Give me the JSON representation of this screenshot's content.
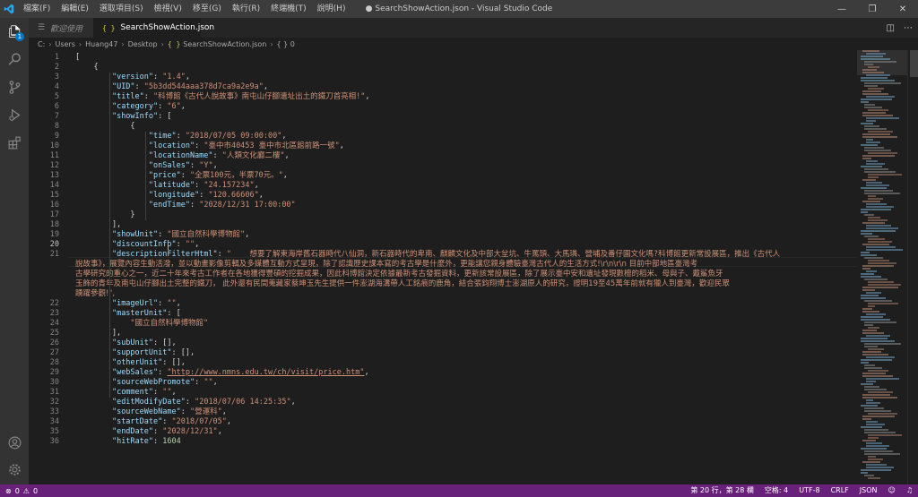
{
  "window": {
    "title": "● SearchShowAction.json - Visual Studio Code",
    "menu": [
      "檔案(F)",
      "編輯(E)",
      "選取項目(S)",
      "檢視(V)",
      "移至(G)",
      "執行(R)",
      "終端機(T)",
      "說明(H)"
    ]
  },
  "activity": {
    "explorer_badge": "1",
    "icons": [
      "files-icon",
      "search-icon",
      "source-control-icon",
      "run-debug-icon",
      "extensions-icon",
      "account-icon",
      "settings-gear-icon"
    ]
  },
  "tabs": [
    {
      "label": "歡迎使用",
      "state": "inactive"
    },
    {
      "label": "SearchShowAction.json",
      "state": "active",
      "modified": true
    }
  ],
  "breadcrumb": {
    "parts": [
      "C:",
      "Users",
      "Huang47",
      "Desktop"
    ],
    "file_glyph": "{ }",
    "file": "SearchShowAction.json",
    "symbol": "{ } 0"
  },
  "editor": {
    "current_line": "20",
    "lines": [
      {
        "n": "1",
        "tokens": [
          [
            "p",
            "["
          ]
        ]
      },
      {
        "n": "2",
        "tokens": [
          [
            "p",
            "    {"
          ]
        ]
      },
      {
        "n": "3",
        "tokens": [
          [
            "p",
            "        "
          ],
          [
            "k",
            "\"version\""
          ],
          [
            "p",
            ": "
          ],
          [
            "s",
            "\"1.4\""
          ],
          [
            "p",
            ","
          ]
        ]
      },
      {
        "n": "4",
        "tokens": [
          [
            "p",
            "        "
          ],
          [
            "k",
            "\"UID\""
          ],
          [
            "p",
            ": "
          ],
          [
            "s",
            "\"5b3dd544aaa378d7ca9a2e9a\""
          ],
          [
            "p",
            ","
          ]
        ]
      },
      {
        "n": "5",
        "tokens": [
          [
            "p",
            "        "
          ],
          [
            "k",
            "\"title\""
          ],
          [
            "p",
            ": "
          ],
          [
            "s",
            "\"科博館《古代人說故事》南屯山仔腳遺址出土的鐵刀首亮相!\""
          ],
          [
            "p",
            ","
          ]
        ]
      },
      {
        "n": "6",
        "tokens": [
          [
            "p",
            "        "
          ],
          [
            "k",
            "\"category\""
          ],
          [
            "p",
            ": "
          ],
          [
            "s",
            "\"6\""
          ],
          [
            "p",
            ","
          ]
        ]
      },
      {
        "n": "7",
        "tokens": [
          [
            "p",
            "        "
          ],
          [
            "k",
            "\"showInfo\""
          ],
          [
            "p",
            ": ["
          ]
        ]
      },
      {
        "n": "8",
        "tokens": [
          [
            "p",
            "            {"
          ]
        ]
      },
      {
        "n": "9",
        "tokens": [
          [
            "p",
            "                "
          ],
          [
            "k",
            "\"time\""
          ],
          [
            "p",
            ": "
          ],
          [
            "s",
            "\"2018/07/05 09:00:00\""
          ],
          [
            "p",
            ","
          ]
        ]
      },
      {
        "n": "10",
        "tokens": [
          [
            "p",
            "                "
          ],
          [
            "k",
            "\"location\""
          ],
          [
            "p",
            ": "
          ],
          [
            "s",
            "\"臺中市40453 臺中市北區館前路一號\""
          ],
          [
            "p",
            ","
          ]
        ]
      },
      {
        "n": "11",
        "tokens": [
          [
            "p",
            "                "
          ],
          [
            "k",
            "\"locationName\""
          ],
          [
            "p",
            ": "
          ],
          [
            "s",
            "\"人類文化廳二樓\""
          ],
          [
            "p",
            ","
          ]
        ]
      },
      {
        "n": "12",
        "tokens": [
          [
            "p",
            "                "
          ],
          [
            "k",
            "\"onSales\""
          ],
          [
            "p",
            ": "
          ],
          [
            "s",
            "\"Y\""
          ],
          [
            "p",
            ","
          ]
        ]
      },
      {
        "n": "13",
        "tokens": [
          [
            "p",
            "                "
          ],
          [
            "k",
            "\"price\""
          ],
          [
            "p",
            ": "
          ],
          [
            "s",
            "\"全票100元，半票70元。\""
          ],
          [
            "p",
            ","
          ]
        ]
      },
      {
        "n": "14",
        "tokens": [
          [
            "p",
            "                "
          ],
          [
            "k",
            "\"latitude\""
          ],
          [
            "p",
            ": "
          ],
          [
            "s",
            "\"24.157234\""
          ],
          [
            "p",
            ","
          ]
        ]
      },
      {
        "n": "15",
        "tokens": [
          [
            "p",
            "                "
          ],
          [
            "k",
            "\"longitude\""
          ],
          [
            "p",
            ": "
          ],
          [
            "s",
            "\"120.66606\""
          ],
          [
            "p",
            ","
          ]
        ]
      },
      {
        "n": "16",
        "tokens": [
          [
            "p",
            "                "
          ],
          [
            "k",
            "\"endTime\""
          ],
          [
            "p",
            ": "
          ],
          [
            "s",
            "\"2028/12/31 17:00:00\""
          ]
        ]
      },
      {
        "n": "17",
        "tokens": [
          [
            "p",
            "            }"
          ]
        ]
      },
      {
        "n": "18",
        "tokens": [
          [
            "p",
            "        ],"
          ]
        ]
      },
      {
        "n": "19",
        "tokens": [
          [
            "p",
            "        "
          ],
          [
            "k",
            "\"showUnit\""
          ],
          [
            "p",
            ": "
          ],
          [
            "s",
            "\"國立自然科學博物館\""
          ],
          [
            "p",
            ","
          ]
        ]
      },
      {
        "n": "20",
        "tokens": [
          [
            "p",
            "        "
          ],
          [
            "k",
            "\"discountInfo\""
          ],
          [
            "p",
            ": "
          ],
          [
            "s",
            "\"\""
          ],
          [
            "p",
            ","
          ]
        ]
      },
      {
        "n": "21",
        "tokens": [
          [
            "p",
            "        "
          ],
          [
            "k",
            "\"descriptionFilterHtml\""
          ],
          [
            "p",
            ": "
          ],
          [
            "s",
            "\"    想要了解東海岸舊石器時代八仙洞，新石器時代的卑南、麒麟文化及中部大坌坑、牛罵頭、大馬璘、營埔及番仔園文化嗎?科博館更新常設展區，推出《古代人"
          ]
        ]
      },
      {
        "n": "",
        "wrap": "說故事》，展覽內容生動活潑，並以動畫影像剪輯及多媒體互動方式呈現，除了認識歷史課本寫的考古學是什麼外，更能讓您親身體驗臺灣古代人的生活方式!\\r\\n\\r\\n     目前中部地區臺灣考"
      },
      {
        "n": "",
        "wrap": "古學研究的重心之一，近二十年來考古工作者在各地獲得豐碩的挖掘成果，因此科博館決定依據最新考古發掘資料，更新該常設展區，除了展示臺中安和遺址發現數檀的稻米、母與子、戴鯊魚牙"
      },
      {
        "n": "",
        "wrap": "玉飾的青年及南屯山仔腳出土完整的鐵刀， 此外還有民間蒐藏家蔡坤玉先生提供一件澎湖海溝帶人工銘痕的鹿角，結合張鈞翔博士澎湖原人的研究，證明19至45萬年前就有獵人到臺灣，歡迎民眾"
      },
      {
        "n": "",
        "wrap": "踴躍參觀!\","
      },
      {
        "n": "22",
        "tokens": [
          [
            "p",
            "        "
          ],
          [
            "k",
            "\"imageUrl\""
          ],
          [
            "p",
            ": "
          ],
          [
            "s",
            "\"\""
          ],
          [
            "p",
            ","
          ]
        ]
      },
      {
        "n": "23",
        "tokens": [
          [
            "p",
            "        "
          ],
          [
            "k",
            "\"masterUnit\""
          ],
          [
            "p",
            ": ["
          ]
        ]
      },
      {
        "n": "24",
        "tokens": [
          [
            "p",
            "            "
          ],
          [
            "s",
            "\"國立自然科學博物館\""
          ]
        ]
      },
      {
        "n": "25",
        "tokens": [
          [
            "p",
            "        ],"
          ]
        ]
      },
      {
        "n": "26",
        "tokens": [
          [
            "p",
            "        "
          ],
          [
            "k",
            "\"subUnit\""
          ],
          [
            "p",
            ": [],"
          ]
        ]
      },
      {
        "n": "27",
        "tokens": [
          [
            "p",
            "        "
          ],
          [
            "k",
            "\"supportUnit\""
          ],
          [
            "p",
            ": [],"
          ]
        ]
      },
      {
        "n": "28",
        "tokens": [
          [
            "p",
            "        "
          ],
          [
            "k",
            "\"otherUnit\""
          ],
          [
            "p",
            ": [],"
          ]
        ]
      },
      {
        "n": "29",
        "tokens": [
          [
            "p",
            "        "
          ],
          [
            "k",
            "\"webSales\""
          ],
          [
            "p",
            ": "
          ],
          [
            "u",
            "\"http://www.nmns.edu.tw/ch/visit/price.htm\""
          ],
          [
            "p",
            ","
          ]
        ]
      },
      {
        "n": "30",
        "tokens": [
          [
            "p",
            "        "
          ],
          [
            "k",
            "\"sourceWebPromote\""
          ],
          [
            "p",
            ": "
          ],
          [
            "s",
            "\"\""
          ],
          [
            "p",
            ","
          ]
        ]
      },
      {
        "n": "31",
        "tokens": [
          [
            "p",
            "        "
          ],
          [
            "k",
            "\"comment\""
          ],
          [
            "p",
            ": "
          ],
          [
            "s",
            "\"\""
          ],
          [
            "p",
            ","
          ]
        ]
      },
      {
        "n": "32",
        "tokens": [
          [
            "p",
            "        "
          ],
          [
            "k",
            "\"editModifyDate\""
          ],
          [
            "p",
            ": "
          ],
          [
            "s",
            "\"2018/07/06 14:25:35\""
          ],
          [
            "p",
            ","
          ]
        ]
      },
      {
        "n": "33",
        "tokens": [
          [
            "p",
            "        "
          ],
          [
            "k",
            "\"sourceWebName\""
          ],
          [
            "p",
            ": "
          ],
          [
            "s",
            "\"營運科\""
          ],
          [
            "p",
            ","
          ]
        ]
      },
      {
        "n": "34",
        "tokens": [
          [
            "p",
            "        "
          ],
          [
            "k",
            "\"startDate\""
          ],
          [
            "p",
            ": "
          ],
          [
            "s",
            "\"2018/07/05\""
          ],
          [
            "p",
            ","
          ]
        ]
      },
      {
        "n": "35",
        "tokens": [
          [
            "p",
            "        "
          ],
          [
            "k",
            "\"endDate\""
          ],
          [
            "p",
            ": "
          ],
          [
            "s",
            "\"2028/12/31\""
          ],
          [
            "p",
            ","
          ]
        ]
      },
      {
        "n": "36",
        "tokens": [
          [
            "p",
            "        "
          ],
          [
            "k",
            "\"hitRate\""
          ],
          [
            "p",
            ": "
          ],
          [
            "n",
            "1604"
          ]
        ]
      }
    ]
  },
  "statusbar": {
    "errors": "0",
    "warnings": "0",
    "position": "第 20 行，第 28 欄",
    "indent": "空格: 4",
    "encoding": "UTF-8",
    "eol": "CRLF",
    "language": "JSON"
  },
  "colors": {
    "statusbar_bg": "#68217a",
    "key": "#9cdcfe",
    "string": "#ce9178",
    "number": "#b5cea8"
  }
}
